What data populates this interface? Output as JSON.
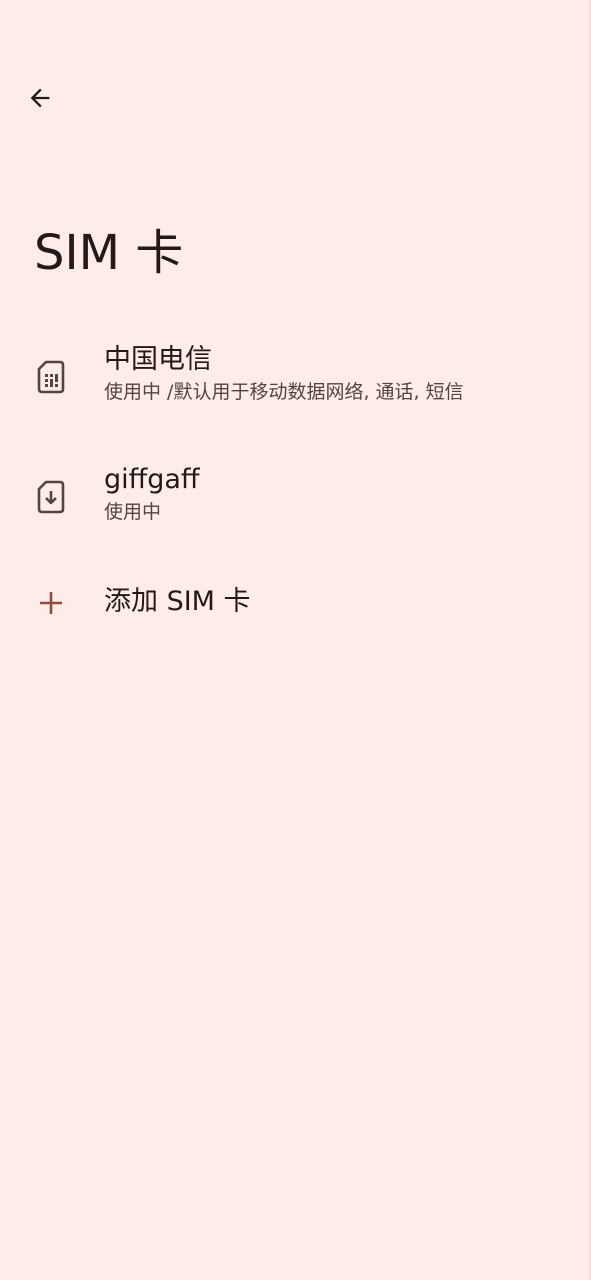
{
  "header": {
    "back_icon": "arrow-back-icon",
    "title": "SIM 卡"
  },
  "sims": [
    {
      "icon": "sim-card-icon",
      "name": "中国电信",
      "status": "使用中 /默认用于移动数据网络, 通话, 短信"
    },
    {
      "icon": "esim-download-icon",
      "name": "giffgaff",
      "status": "使用中"
    }
  ],
  "add_sim": {
    "icon": "plus-icon",
    "label": "添加 SIM 卡"
  },
  "colors": {
    "background": "#fdecea",
    "text_primary": "#231917",
    "text_secondary": "#534341",
    "accent": "#8f4c38"
  }
}
